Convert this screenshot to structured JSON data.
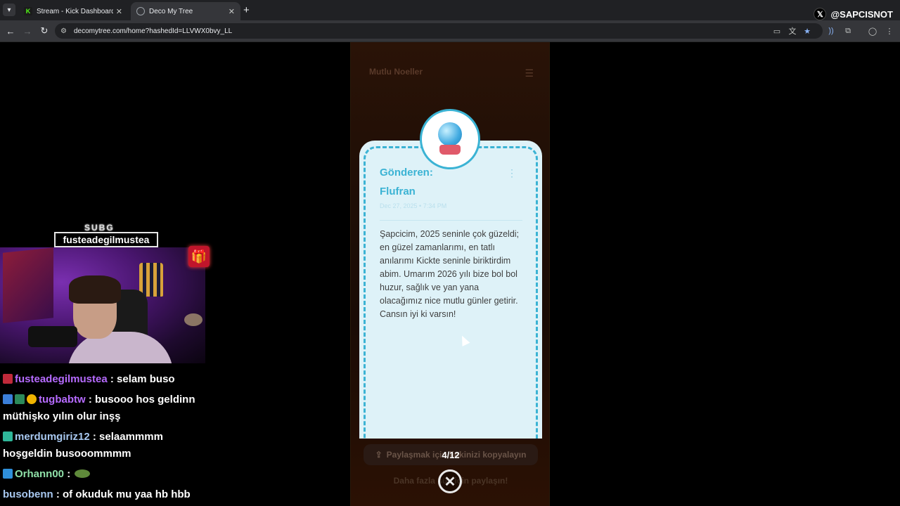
{
  "browser": {
    "tabs": [
      {
        "title": "Stream - Kick Dashboard",
        "favicon": "kick-icon"
      },
      {
        "title": "Deco My Tree",
        "favicon": "globe-icon"
      }
    ],
    "url": "decomytree.com/home?hashedId=LLVWX0bvy_LL"
  },
  "overlay": {
    "x_handle": "@SAPCISNOT",
    "sub_badge": "SUBG",
    "sub_name": "fusteadegilmustea"
  },
  "chat": [
    {
      "user": "fusteadegilmustea",
      "user_color": "#b66bff",
      "text": ": selam buso",
      "badges": [
        "#c02a3a"
      ]
    },
    {
      "user": "tugbabtw",
      "user_color": "#b66bff",
      "text": ": busooo hos geldinn müthişko yılın olur inşş",
      "badges": [
        "#3b7fd9",
        "#2c8a5a",
        "#f0b400"
      ]
    },
    {
      "user": "merdumgiriz12",
      "user_color": "#a8c8f0",
      "text": ": selaammmm hoşgeldin busooommmm",
      "badges": [
        "#2fb79a"
      ]
    },
    {
      "user": "Orhann00",
      "user_color": "#8fe0a8",
      "text": ":",
      "badges": [
        "#2f8fd9"
      ]
    },
    {
      "user": "busobenn",
      "user_color": "#a8c8f0",
      "text": ": of okuduk mu yaa hb hbb",
      "badges": []
    }
  ],
  "site": {
    "title": "Mutlu Noeller",
    "letter": {
      "from_label": "Gönderen:",
      "from_name": "Flufran",
      "date": "Dec 27, 2025 • 7:34 PM",
      "message": "Şapcicim, 2025 seninle çok güzeldi; en güzel zamanlarımı, en tatlı anılarımı Kickte seninle biriktirdim abim. Umarım 2026 yılı bize bol bol huzur, sağlık ve yan yana olacağımız nice mutlu günler getirir. Cansın iyi ki varsın!"
    },
    "share_button": "Paylaşmak için linkinizi kopyalayın",
    "counter": "4/12",
    "more_text": "Daha fazla süs için paylaşın!"
  },
  "colors": {
    "accent": "#3bb3d4",
    "letter_bg": "#def2f8"
  }
}
